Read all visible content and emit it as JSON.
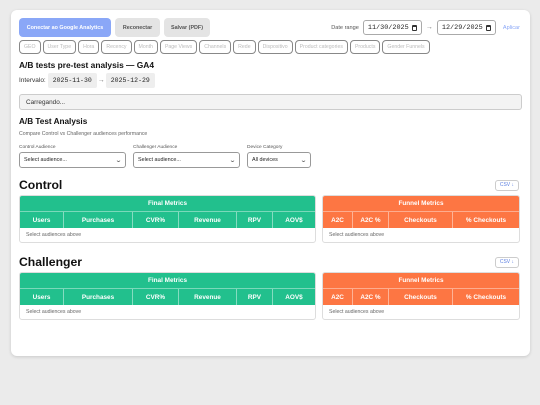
{
  "toolbar": {
    "connect_label": "Conectar ao Google Analytics",
    "reconnect_label": "Reconectar",
    "save_pdf_label": "Salvar (PDF)",
    "date_range_label": "Date range",
    "date_start": "11/30/2025",
    "date_end": "12/29/2025",
    "apply_label": "Aplicar"
  },
  "chips": [
    "GEO",
    "User Type",
    "Hora",
    "Recency",
    "Month",
    "Page Views",
    "Channels",
    "Rede",
    "Dispositivo",
    "Product categories",
    "Products",
    "Gender Funnels"
  ],
  "analysis": {
    "title": "A/B tests pre-test analysis — GA4",
    "interval_label": "Intervalo:",
    "interval_start": "2025-11-30",
    "interval_end": "2025-12-29",
    "loading": "Carregando..."
  },
  "ab": {
    "title": "A/B Test Analysis",
    "subtitle": "Compare Control vs Challenger audiences performance",
    "control_label": "Control Audience",
    "control_value": "Select audience...",
    "challenger_label": "Challenger Audience",
    "challenger_value": "Select audience...",
    "device_label": "Device Category",
    "device_value": "All devices"
  },
  "control": {
    "title": "Control",
    "csv": "CSV ↓",
    "final_title": "Final Metrics",
    "final_cols": [
      "Users",
      "Purchases",
      "CVR%",
      "Revenue",
      "RPV",
      "AOV$"
    ],
    "funnel_title": "Funnel Metrics",
    "funnel_cols": [
      "A2C",
      "A2C %",
      "Checkouts",
      "% Checkouts"
    ],
    "empty": "Select audiences above"
  },
  "challenger": {
    "title": "Challenger",
    "csv": "CSV ↓",
    "final_title": "Final Metrics",
    "final_cols": [
      "Users",
      "Purchases",
      "CVR%",
      "Revenue",
      "RPV",
      "AOV$"
    ],
    "funnel_title": "Funnel Metrics",
    "funnel_cols": [
      "A2C",
      "A2C %",
      "Checkouts",
      "% Checkouts"
    ],
    "empty": "Select audiences above"
  },
  "colors": {
    "primary": "#8aa7f7",
    "final_header": "#22c08d",
    "funnel_header": "#fd7643"
  }
}
